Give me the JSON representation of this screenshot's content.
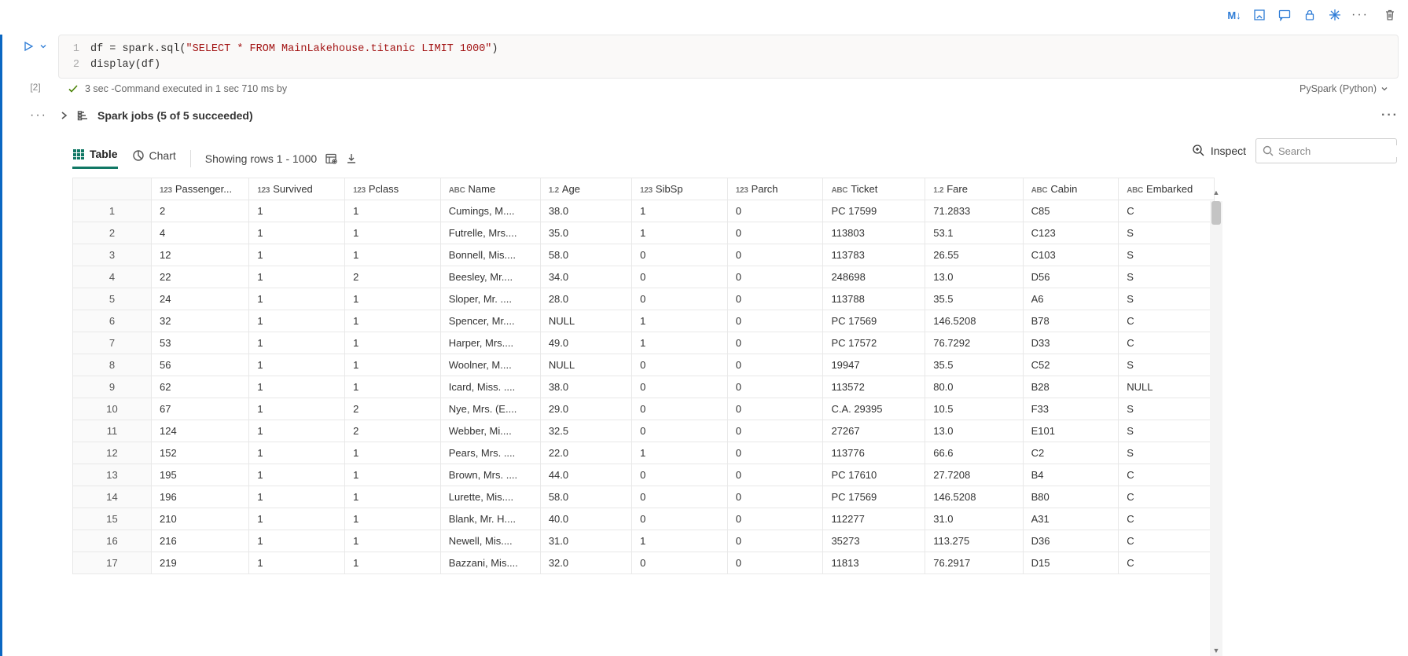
{
  "toolbar": {
    "markdown": "M↓",
    "more": "···"
  },
  "exec": {
    "count_label": "[2]",
    "code_lines": [
      {
        "n": "1",
        "prefix": "df = spark.sql(",
        "str": "\"SELECT * FROM MainLakehouse.titanic LIMIT 1000\"",
        "suffix": ")"
      },
      {
        "n": "2",
        "prefix": "display(df)",
        "str": "",
        "suffix": ""
      }
    ],
    "status": "3 sec -Command executed in 1 sec 710 ms by",
    "language": "PySpark (Python)"
  },
  "spark_jobs": {
    "label": "Spark jobs (5 of 5 succeeded)"
  },
  "view": {
    "table": "Table",
    "chart": "Chart",
    "rows_info": "Showing rows 1 - 1000",
    "inspect": "Inspect",
    "search_placeholder": "Search"
  },
  "table": {
    "columns": [
      {
        "dtype": "123",
        "name": "Passenger..."
      },
      {
        "dtype": "123",
        "name": "Survived"
      },
      {
        "dtype": "123",
        "name": "Pclass"
      },
      {
        "dtype": "ABC",
        "name": "Name"
      },
      {
        "dtype": "1.2",
        "name": "Age"
      },
      {
        "dtype": "123",
        "name": "SibSp"
      },
      {
        "dtype": "123",
        "name": "Parch"
      },
      {
        "dtype": "ABC",
        "name": "Ticket"
      },
      {
        "dtype": "1.2",
        "name": "Fare"
      },
      {
        "dtype": "ABC",
        "name": "Cabin"
      },
      {
        "dtype": "ABC",
        "name": "Embarked"
      }
    ],
    "rows": [
      {
        "n": "1",
        "PassengerId": "2",
        "Survived": "1",
        "Pclass": "1",
        "Name": "Cumings, M....",
        "Age": "38.0",
        "SibSp": "1",
        "Parch": "0",
        "Ticket": "PC 17599",
        "Fare": "71.2833",
        "Cabin": "C85",
        "Embarked": "C"
      },
      {
        "n": "2",
        "PassengerId": "4",
        "Survived": "1",
        "Pclass": "1",
        "Name": "Futrelle, Mrs....",
        "Age": "35.0",
        "SibSp": "1",
        "Parch": "0",
        "Ticket": "113803",
        "Fare": "53.1",
        "Cabin": "C123",
        "Embarked": "S"
      },
      {
        "n": "3",
        "PassengerId": "12",
        "Survived": "1",
        "Pclass": "1",
        "Name": "Bonnell, Mis....",
        "Age": "58.0",
        "SibSp": "0",
        "Parch": "0",
        "Ticket": "113783",
        "Fare": "26.55",
        "Cabin": "C103",
        "Embarked": "S"
      },
      {
        "n": "4",
        "PassengerId": "22",
        "Survived": "1",
        "Pclass": "2",
        "Name": "Beesley, Mr....",
        "Age": "34.0",
        "SibSp": "0",
        "Parch": "0",
        "Ticket": "248698",
        "Fare": "13.0",
        "Cabin": "D56",
        "Embarked": "S"
      },
      {
        "n": "5",
        "PassengerId": "24",
        "Survived": "1",
        "Pclass": "1",
        "Name": "Sloper, Mr. ....",
        "Age": "28.0",
        "SibSp": "0",
        "Parch": "0",
        "Ticket": "113788",
        "Fare": "35.5",
        "Cabin": "A6",
        "Embarked": "S"
      },
      {
        "n": "6",
        "PassengerId": "32",
        "Survived": "1",
        "Pclass": "1",
        "Name": "Spencer, Mr....",
        "Age": "NULL",
        "SibSp": "1",
        "Parch": "0",
        "Ticket": "PC 17569",
        "Fare": "146.5208",
        "Cabin": "B78",
        "Embarked": "C"
      },
      {
        "n": "7",
        "PassengerId": "53",
        "Survived": "1",
        "Pclass": "1",
        "Name": "Harper, Mrs....",
        "Age": "49.0",
        "SibSp": "1",
        "Parch": "0",
        "Ticket": "PC 17572",
        "Fare": "76.7292",
        "Cabin": "D33",
        "Embarked": "C"
      },
      {
        "n": "8",
        "PassengerId": "56",
        "Survived": "1",
        "Pclass": "1",
        "Name": "Woolner, M....",
        "Age": "NULL",
        "SibSp": "0",
        "Parch": "0",
        "Ticket": "19947",
        "Fare": "35.5",
        "Cabin": "C52",
        "Embarked": "S"
      },
      {
        "n": "9",
        "PassengerId": "62",
        "Survived": "1",
        "Pclass": "1",
        "Name": "Icard, Miss. ....",
        "Age": "38.0",
        "SibSp": "0",
        "Parch": "0",
        "Ticket": "113572",
        "Fare": "80.0",
        "Cabin": "B28",
        "Embarked": "NULL"
      },
      {
        "n": "10",
        "PassengerId": "67",
        "Survived": "1",
        "Pclass": "2",
        "Name": "Nye, Mrs. (E....",
        "Age": "29.0",
        "SibSp": "0",
        "Parch": "0",
        "Ticket": "C.A. 29395",
        "Fare": "10.5",
        "Cabin": "F33",
        "Embarked": "S"
      },
      {
        "n": "11",
        "PassengerId": "124",
        "Survived": "1",
        "Pclass": "2",
        "Name": "Webber, Mi....",
        "Age": "32.5",
        "SibSp": "0",
        "Parch": "0",
        "Ticket": "27267",
        "Fare": "13.0",
        "Cabin": "E101",
        "Embarked": "S"
      },
      {
        "n": "12",
        "PassengerId": "152",
        "Survived": "1",
        "Pclass": "1",
        "Name": "Pears, Mrs. ....",
        "Age": "22.0",
        "SibSp": "1",
        "Parch": "0",
        "Ticket": "113776",
        "Fare": "66.6",
        "Cabin": "C2",
        "Embarked": "S"
      },
      {
        "n": "13",
        "PassengerId": "195",
        "Survived": "1",
        "Pclass": "1",
        "Name": "Brown, Mrs. ....",
        "Age": "44.0",
        "SibSp": "0",
        "Parch": "0",
        "Ticket": "PC 17610",
        "Fare": "27.7208",
        "Cabin": "B4",
        "Embarked": "C"
      },
      {
        "n": "14",
        "PassengerId": "196",
        "Survived": "1",
        "Pclass": "1",
        "Name": "Lurette, Mis....",
        "Age": "58.0",
        "SibSp": "0",
        "Parch": "0",
        "Ticket": "PC 17569",
        "Fare": "146.5208",
        "Cabin": "B80",
        "Embarked": "C"
      },
      {
        "n": "15",
        "PassengerId": "210",
        "Survived": "1",
        "Pclass": "1",
        "Name": "Blank, Mr. H....",
        "Age": "40.0",
        "SibSp": "0",
        "Parch": "0",
        "Ticket": "112277",
        "Fare": "31.0",
        "Cabin": "A31",
        "Embarked": "C"
      },
      {
        "n": "16",
        "PassengerId": "216",
        "Survived": "1",
        "Pclass": "1",
        "Name": "Newell, Mis....",
        "Age": "31.0",
        "SibSp": "1",
        "Parch": "0",
        "Ticket": "35273",
        "Fare": "113.275",
        "Cabin": "D36",
        "Embarked": "C"
      },
      {
        "n": "17",
        "PassengerId": "219",
        "Survived": "1",
        "Pclass": "1",
        "Name": "Bazzani, Mis....",
        "Age": "32.0",
        "SibSp": "0",
        "Parch": "0",
        "Ticket": "11813",
        "Fare": "76.2917",
        "Cabin": "D15",
        "Embarked": "C"
      }
    ]
  }
}
